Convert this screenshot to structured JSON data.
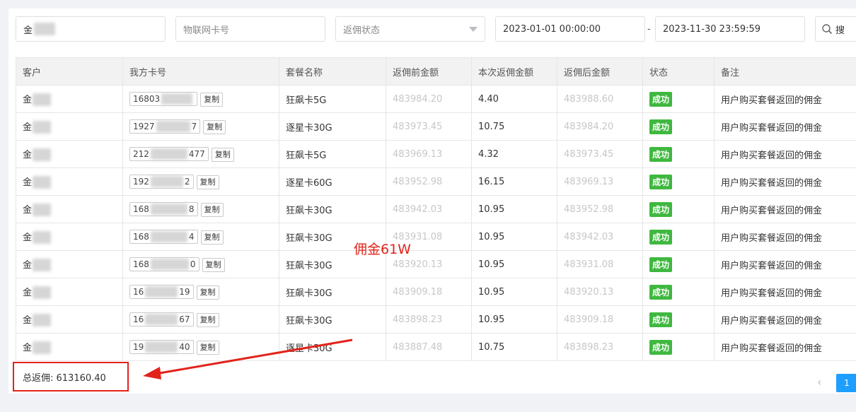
{
  "filters": {
    "customer_visible": "金",
    "card_placeholder": "物联网卡号",
    "status_placeholder": "返佣状态",
    "start_date": "2023-01-01 00:00:00",
    "separator": "-",
    "end_date": "2023-11-30 23:59:59",
    "search_label": "搜"
  },
  "table": {
    "headers": [
      "客户",
      "我方卡号",
      "套餐名称",
      "返佣前金额",
      "本次返佣金额",
      "返佣后金额",
      "状态",
      "备注"
    ],
    "copy_label": "复制",
    "rows": [
      {
        "customer": "金",
        "card_start": "16803",
        "card_end": "",
        "package": "狂飙卡5G",
        "before": "483984.20",
        "amount": "4.40",
        "after": "483988.60",
        "status": "成功",
        "note": "用户购买套餐返回的佣金"
      },
      {
        "customer": "金",
        "card_start": "1927",
        "card_end": "7",
        "package": "逐星卡30G",
        "before": "483973.45",
        "amount": "10.75",
        "after": "483984.20",
        "status": "成功",
        "note": "用户购买套餐返回的佣金"
      },
      {
        "customer": "金",
        "card_start": "212",
        "card_end": "477",
        "package": "狂飙卡5G",
        "before": "483969.13",
        "amount": "4.32",
        "after": "483973.45",
        "status": "成功",
        "note": "用户购买套餐返回的佣金"
      },
      {
        "customer": "金",
        "card_start": "192",
        "card_end": "2",
        "package": "逐星卡60G",
        "before": "483952.98",
        "amount": "16.15",
        "after": "483969.13",
        "status": "成功",
        "note": "用户购买套餐返回的佣金"
      },
      {
        "customer": "金",
        "card_start": "168",
        "card_end": "8",
        "package": "狂飙卡30G",
        "before": "483942.03",
        "amount": "10.95",
        "after": "483952.98",
        "status": "成功",
        "note": "用户购买套餐返回的佣金"
      },
      {
        "customer": "金",
        "card_start": "168",
        "card_end": "4",
        "package": "狂飙卡30G",
        "before": "483931.08",
        "amount": "10.95",
        "after": "483942.03",
        "status": "成功",
        "note": "用户购买套餐返回的佣金"
      },
      {
        "customer": "金",
        "card_start": "168",
        "card_end": "0",
        "package": "狂飙卡30G",
        "before": "483920.13",
        "amount": "10.95",
        "after": "483931.08",
        "status": "成功",
        "note": "用户购买套餐返回的佣金"
      },
      {
        "customer": "金",
        "card_start": "16",
        "card_end": "19",
        "package": "狂飙卡30G",
        "before": "483909.18",
        "amount": "10.95",
        "after": "483920.13",
        "status": "成功",
        "note": "用户购买套餐返回的佣金"
      },
      {
        "customer": "金",
        "card_start": "16",
        "card_end": "67",
        "package": "狂飙卡30G",
        "before": "483898.23",
        "amount": "10.95",
        "after": "483909.18",
        "status": "成功",
        "note": "用户购买套餐返回的佣金"
      },
      {
        "customer": "金",
        "card_start": "19",
        "card_end": "40",
        "package": "逐星卡30G",
        "before": "483887.48",
        "amount": "10.75",
        "after": "483898.23",
        "status": "成功",
        "note": "用户购买套餐返回的佣金"
      }
    ]
  },
  "footer": {
    "total_label": "总返佣: 613160.40",
    "prev_symbol": "‹",
    "current_page": "1"
  },
  "annotation": {
    "text": "佣金61W",
    "color": "#e2231a"
  },
  "colors": {
    "success": "#3fb83f",
    "primary": "#1e9fff",
    "muted": "#c7c7c7"
  }
}
